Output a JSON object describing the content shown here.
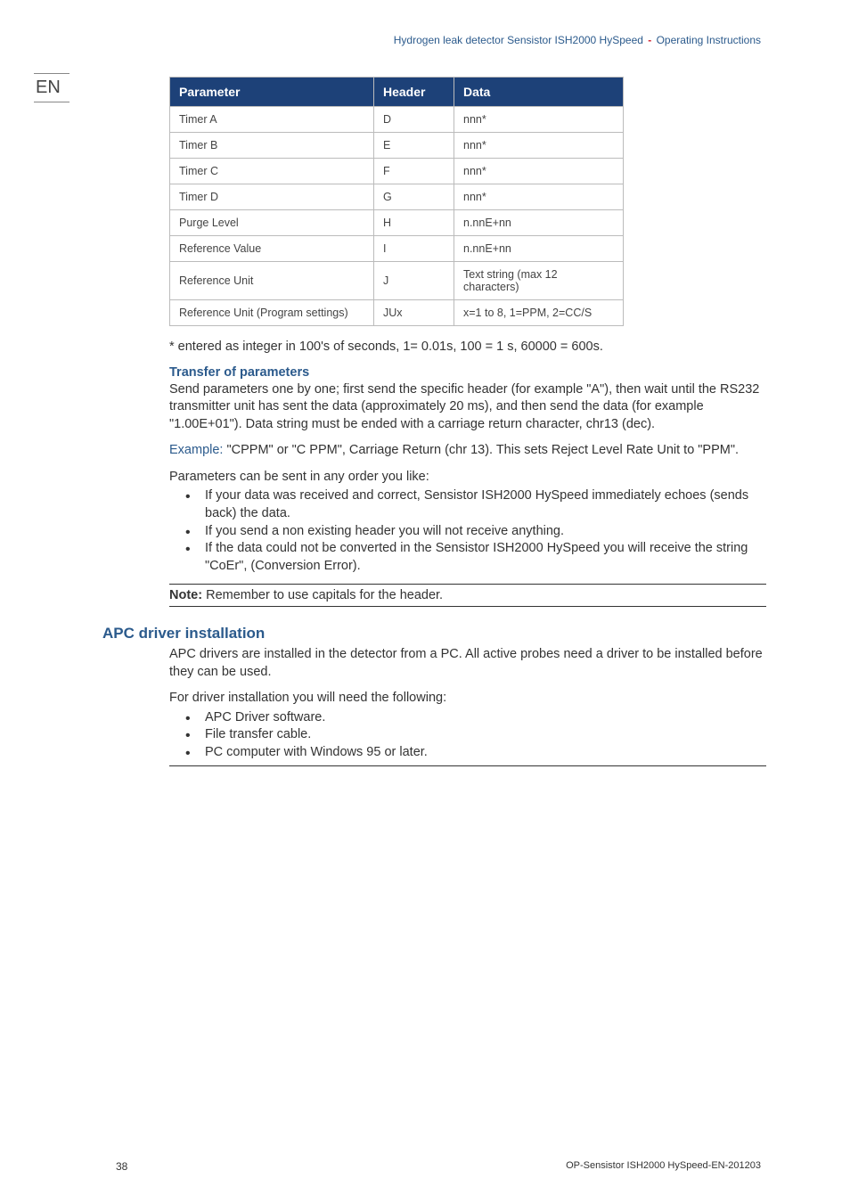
{
  "header": {
    "part1": "Hydrogen leak detector Sensistor ISH2000 HySpeed ",
    "part2": " Operating Instructions"
  },
  "lang": "EN",
  "table": {
    "columns": [
      "Parameter",
      "Header",
      "Data"
    ],
    "rows": [
      {
        "parameter": "Timer A",
        "header": "D",
        "data": "nnn*"
      },
      {
        "parameter": "Timer B",
        "header": "E",
        "data": "nnn*"
      },
      {
        "parameter": "Timer C",
        "header": "F",
        "data": "nnn*"
      },
      {
        "parameter": "Timer D",
        "header": "G",
        "data": "nnn*"
      },
      {
        "parameter": "Purge Level",
        "header": "H",
        "data": "n.nnE+nn"
      },
      {
        "parameter": "Reference Value",
        "header": "I",
        "data": "n.nnE+nn"
      },
      {
        "parameter": "Reference Unit",
        "header": "J",
        "data": "Text string (max 12 characters)"
      },
      {
        "parameter": "Reference Unit (Program settings)",
        "header": "JUx",
        "data": "x=1 to 8, 1=PPM, 2=CC/S"
      }
    ]
  },
  "footnote": "* entered as integer in 100's of seconds, 1= 0.01s, 100 = 1 s, 60000 = 600s.",
  "transfer": {
    "heading": "Transfer of parameters",
    "para": "Send parameters one by one; first send the specific header (for example \"A\"), then wait until the RS232 transmitter unit has sent the data (approximately 20 ms), and then send the data (for example \"1.00E+01\"). Data string must be ended with a carriage return character, chr13 (dec)."
  },
  "example": {
    "label": "Example:",
    "text": " \"CPPM\" or \"C PPM\", Carriage Return (chr 13). This sets Reject Level Rate Unit to \"PPM\"."
  },
  "order_line": "Parameters can be sent in any order you like:",
  "order_bullets": [
    "If your data was received and correct, Sensistor ISH2000 HySpeed immediately echoes (sends back) the data.",
    "If you send a non existing header you will not receive anything.",
    "If the data could not be converted in the Sensistor ISH2000 HySpeed you will receive the string \"CoEr\", (Conversion Error)."
  ],
  "note": {
    "label": "Note:",
    "text": " Remember to use capitals for the header."
  },
  "apc": {
    "heading": "APC driver installation",
    "para": "APC drivers are installed in the detector from a PC. All active probes need a driver to be installed before they can be used.",
    "need_line": "For driver installation you will need the following:",
    "bullets": [
      "APC Driver software.",
      "File transfer cable.",
      "PC computer with Windows 95 or later."
    ]
  },
  "footer": {
    "page": "38",
    "docid": "OP-Sensistor ISH2000 HySpeed-EN-201203"
  }
}
